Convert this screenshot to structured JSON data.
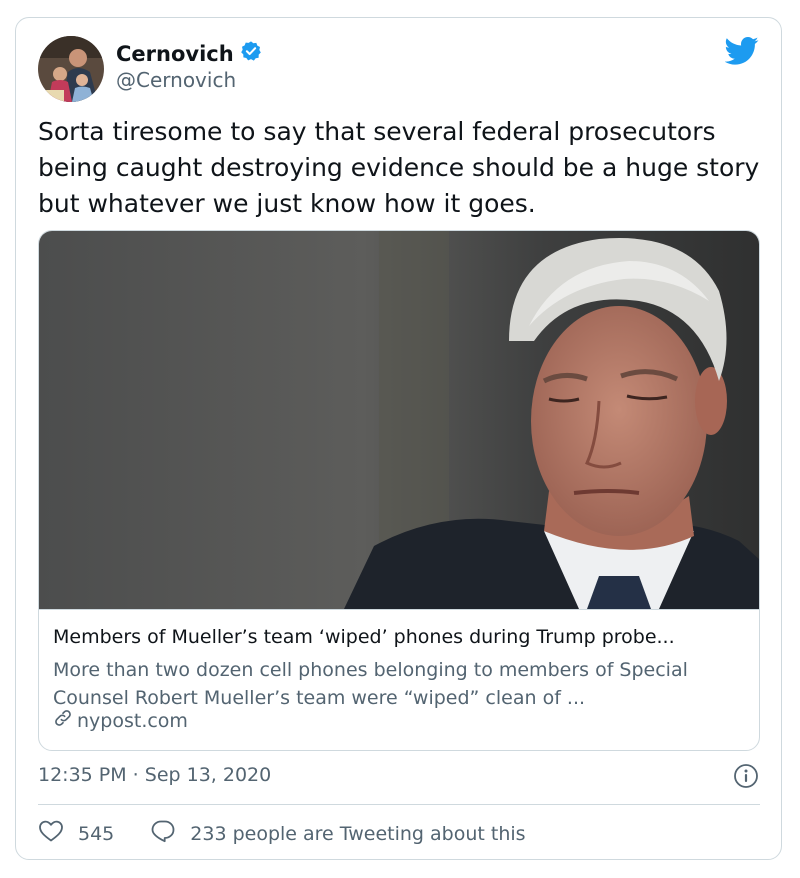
{
  "tweet": {
    "author_name": "Cernovich",
    "handle": "@Cernovich",
    "text": "Sorta tiresome to say that several federal prosecutors being caught destroying evidence should be a huge story but whatever we just know how it goes.",
    "timestamp": "12:35 PM · Sep 13, 2020",
    "likes": "545",
    "replies_label": "233 people are Tweeting about this"
  },
  "link_card": {
    "title": "Members of Mueller’s team ‘wiped’ phones during Trump probe...",
    "description": "More than two dozen cell phones belonging to members of Special Counsel Robert Mueller’s team were “wiped” clean of ...",
    "domain": "nypost.com"
  },
  "colors": {
    "twitter_blue": "#1d9bf0",
    "secondary_text": "#536471",
    "border": "#cfd9de"
  },
  "icons": [
    "verified-badge-icon",
    "twitter-bird-icon",
    "link-icon",
    "info-icon",
    "heart-icon",
    "reply-bubble-icon"
  ]
}
